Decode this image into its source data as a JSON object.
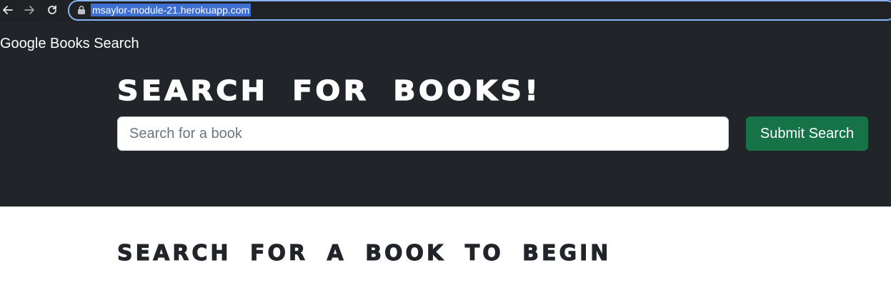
{
  "browser": {
    "url": "msaylor-module-21.herokuapp.com",
    "icons": {
      "back": "arrow-left-icon",
      "forward": "arrow-right-icon",
      "reload": "reload-icon",
      "lock": "lock-icon"
    }
  },
  "navbar": {
    "brand": "Google Books Search"
  },
  "hero": {
    "title": "SEARCH FOR BOOKS!",
    "search_placeholder": "Search for a book",
    "submit_label": "Submit Search"
  },
  "results": {
    "heading": "SEARCH FOR A BOOK TO BEGIN"
  },
  "colors": {
    "navbar_bg": "#212529",
    "button_success": "#157347",
    "url_highlight": "#3c6fd1",
    "focus_ring": "#8ab4f8"
  }
}
